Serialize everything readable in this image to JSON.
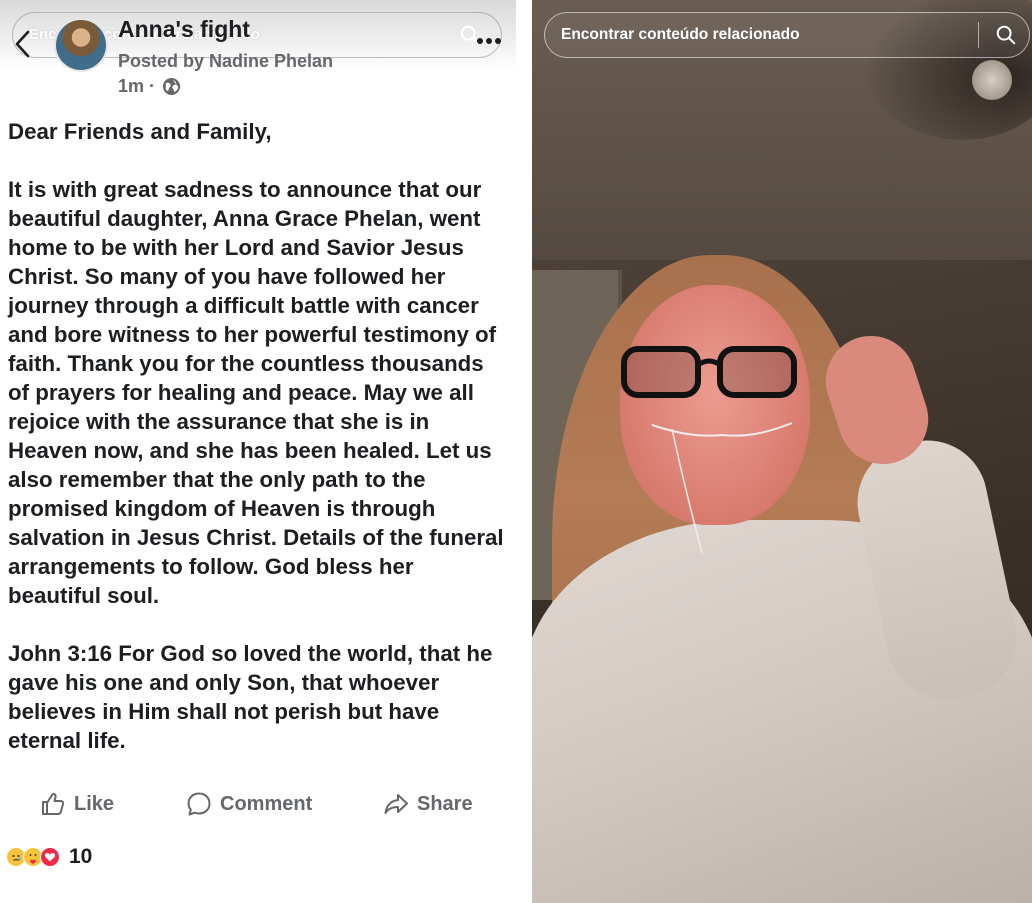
{
  "post": {
    "ghost_search_text": "Encontrar conteúdo relacionado",
    "title": "Anna's fight",
    "posted_by": "Posted by Nadine Phelan",
    "time": "1m ·",
    "body": [
      "Dear Friends and Family,",
      "It is with great sadness to announce that our beautiful daughter, Anna Grace Phelan, went home to be with her Lord and Savior Jesus Christ. So many of you have followed her journey through a difficult battle with cancer and bore witness to her powerful testimony of faith. Thank you for the countless thousands of prayers for healing and peace. May we all rejoice with the assurance that she is in Heaven now, and she has been healed. Let us also remember that the only path to the promised kingdom of Heaven is through salvation in Jesus Christ. Details of the funeral arrangements to follow. God bless her beautiful soul.",
      "John 3:16 For God so loved the world, that he gave his one and only Son, that whoever believes in Him shall not perish but have eternal life."
    ],
    "actions": {
      "like": "Like",
      "comment": "Comment",
      "share": "Share"
    },
    "reactions": {
      "icons": [
        "sad-reaction-icon",
        "care-reaction-icon",
        "love-reaction-icon"
      ],
      "count": "10"
    }
  },
  "video": {
    "search_placeholder": "Encontrar conteúdo relacionado",
    "icons": [
      "search-icon"
    ]
  },
  "colors": {
    "text_primary": "#1c1e21",
    "text_secondary": "#65676b",
    "love": "#f0284a",
    "haha_yellow": "#f7c33b"
  }
}
